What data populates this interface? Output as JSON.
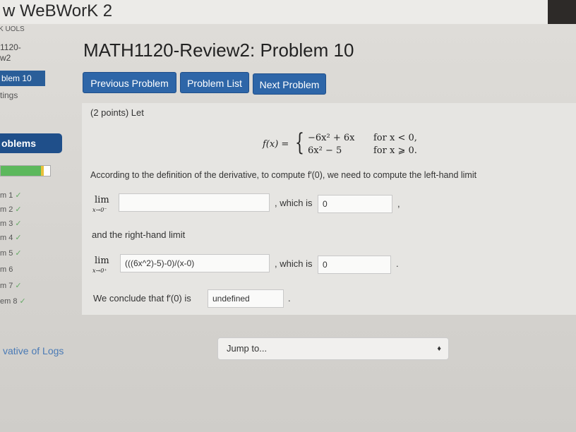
{
  "app": {
    "title": "w WeBWorK 2"
  },
  "sidebar": {
    "top_cut": "K UOLS",
    "course_line1": "1120-",
    "course_line2": "w2",
    "active_item": "blem 10",
    "settings": "tings",
    "problems_header": "oblems",
    "progress": {
      "correct_fraction": 0.82,
      "partial_fraction": 0.06
    },
    "problem_list": [
      {
        "label": "m 1",
        "mark": "✓"
      },
      {
        "label": "m 2",
        "mark": "✓"
      },
      {
        "label": "m 3",
        "mark": "✓"
      },
      {
        "label": "m 4",
        "mark": "✓"
      },
      {
        "label": "m 5",
        "mark": "✓"
      },
      {
        "label": "m 6",
        "mark": ""
      },
      {
        "label": "m 7",
        "mark": "✓"
      },
      {
        "label": "em 8",
        "mark": "✓"
      }
    ],
    "footer_link": "vative of Logs"
  },
  "main": {
    "title": "MATH1120-Review2: Problem 10",
    "buttons": {
      "previous": "Previous Problem",
      "list": "Problem List",
      "next": "Next Problem"
    },
    "intro": "(2 points) Let",
    "piecewise": {
      "lhs": "f(x) =",
      "row1_expr": "−6x² + 6x",
      "row1_cond": "for x < 0,",
      "row2_expr": "6x² − 5",
      "row2_cond": "for x ⩾ 0."
    },
    "definition_text": "According to the definition of the derivative, to compute f′(0), we need to compute the left-hand limit",
    "left_limit": {
      "lim": "lim",
      "sub": "x→0⁻",
      "input_value": "",
      "which_is": ", which is",
      "result": "0",
      "trail": ","
    },
    "and_text": "and the right-hand limit",
    "right_limit": {
      "lim": "lim",
      "sub": "x→0⁺",
      "input_value": "(((6x^2)-5)-0)/(x-0)",
      "which_is": ", which is",
      "result": "0",
      "trail": "."
    },
    "conclude": {
      "text": "We conclude that f′(0) is",
      "value": "undefined",
      "trail": "."
    },
    "jump": {
      "label": "Jump to...",
      "arrow": "♦"
    }
  }
}
